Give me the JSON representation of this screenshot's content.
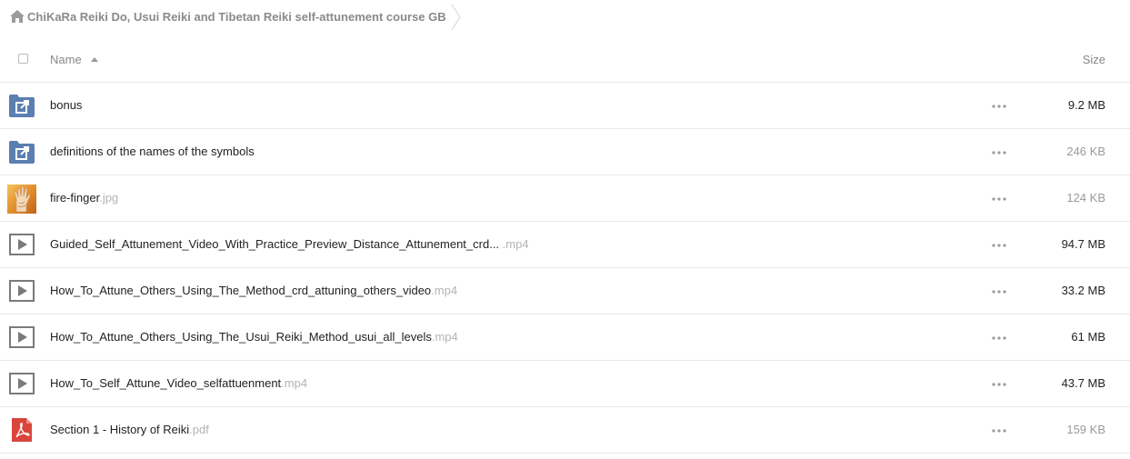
{
  "breadcrumb": {
    "home_icon": "home-icon",
    "path": "ChiKaRa Reiki Do, Usui Reiki and Tibetan Reiki self-attunement course GB"
  },
  "table": {
    "col_name": "Name",
    "col_size": "Size",
    "sort": "ascending"
  },
  "files": [
    {
      "name": "bonus",
      "ext": "",
      "size": "9.2 MB",
      "icon": "shared-folder-icon",
      "size_muted": false
    },
    {
      "name": "definitions of the names of the symbols",
      "ext": "",
      "size": "246 KB",
      "icon": "shared-folder-icon",
      "size_muted": true
    },
    {
      "name": "fire-finger",
      "ext": ".jpg",
      "size": "124 KB",
      "icon": "image-thumbnail",
      "size_muted": true
    },
    {
      "name": "Guided_Self_Attunement_Video_With_Practice_Preview_Distance_Attunement_crd...",
      "ext": " .mp4",
      "size": "94.7 MB",
      "icon": "video-icon",
      "size_muted": false
    },
    {
      "name": "How_To_Attune_Others_Using_The_Method_crd_attuning_others_video",
      "ext": ".mp4",
      "size": "33.2 MB",
      "icon": "video-icon",
      "size_muted": false
    },
    {
      "name": "How_To_Attune_Others_Using_The_Usui_Reiki_Method_usui_all_levels",
      "ext": ".mp4",
      "size": "61 MB",
      "icon": "video-icon",
      "size_muted": false
    },
    {
      "name": "How_To_Self_Attune_Video_selfattuenment",
      "ext": ".mp4",
      "size": "43.7 MB",
      "icon": "video-icon",
      "size_muted": false
    },
    {
      "name": "Section 1 - History of Reiki",
      "ext": ".pdf",
      "size": "159 KB",
      "icon": "pdf-icon",
      "size_muted": true
    }
  ],
  "colors": {
    "folder": "#5b7fb0",
    "pdf": "#d9453b",
    "video": "#7a7a7a",
    "muted_text": "#b3b3b3"
  }
}
